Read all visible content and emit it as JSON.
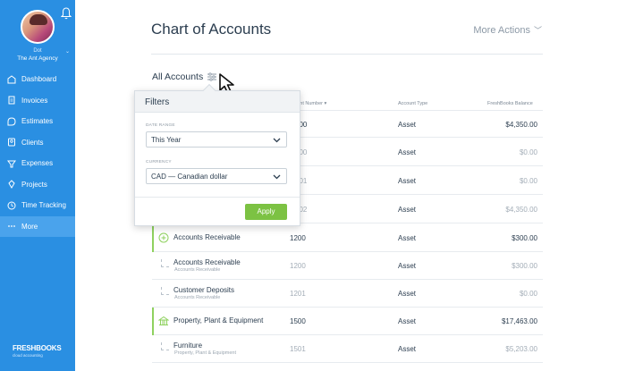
{
  "sidebar": {
    "user_name": "Dot",
    "agency": "The Ant Agency",
    "items": [
      {
        "label": "Dashboard",
        "icon": "dashboard-icon"
      },
      {
        "label": "Invoices",
        "icon": "invoice-icon"
      },
      {
        "label": "Estimates",
        "icon": "estimate-icon"
      },
      {
        "label": "Clients",
        "icon": "client-icon"
      },
      {
        "label": "Expenses",
        "icon": "expense-icon"
      },
      {
        "label": "Projects",
        "icon": "project-icon"
      },
      {
        "label": "Time Tracking",
        "icon": "clock-icon"
      },
      {
        "label": "More",
        "icon": "more-dots-icon"
      }
    ],
    "active_item": "More",
    "logo": "FRESHBOOKS",
    "logo_sub": "cloud accounting",
    "colors": {
      "background": "#2a8fe2",
      "active": "#4aa3ec"
    }
  },
  "header": {
    "title": "Chart of Accounts",
    "more_actions": "More Actions"
  },
  "filter_bar": {
    "label": "All Accounts"
  },
  "table": {
    "columns": [
      "Account Number",
      "Account Type",
      "FreshBooks Balance"
    ],
    "rows": [
      {
        "number": "1000",
        "visible_number": "000",
        "type": "Asset",
        "balance": "$4,350.00",
        "child": false
      },
      {
        "number": "1001",
        "visible_number": "000",
        "type": "Asset",
        "balance": "$0.00",
        "child": true
      },
      {
        "number": "1001",
        "visible_number": "001",
        "type": "Asset",
        "balance": "$0.00",
        "child": true
      },
      {
        "number": "1002",
        "visible_number": "002",
        "type": "Asset",
        "balance": "$4,350.00",
        "child": true
      },
      {
        "name": "Accounts Receivable",
        "number": "1200",
        "type": "Asset",
        "balance": "$300.00",
        "child": false,
        "icon": "plus-circle-icon"
      },
      {
        "name": "Accounts Receivable",
        "sub": "Accounts Receivable",
        "number": "1200",
        "type": "Asset",
        "balance": "$300.00",
        "child": true
      },
      {
        "name": "Customer Deposits",
        "sub": "Accounts Receivable",
        "number": "1201",
        "type": "Asset",
        "balance": "$0.00",
        "child": true
      },
      {
        "name": "Property, Plant & Equipment",
        "number": "1500",
        "type": "Asset",
        "balance": "$17,463.00",
        "child": false,
        "icon": "building-icon"
      },
      {
        "name": "Furniture",
        "sub": "Property, Plant & Equipment",
        "number": "1501",
        "type": "Asset",
        "balance": "$5,203.00",
        "child": true
      }
    ]
  },
  "filters_popover": {
    "title": "Filters",
    "date_range_label": "DATE RANGE",
    "date_range_value": "This Year",
    "currency_label": "CURRENCY",
    "currency_value": "CAD — Canadian dollar",
    "apply_label": "Apply",
    "apply_color": "#7cc243"
  }
}
